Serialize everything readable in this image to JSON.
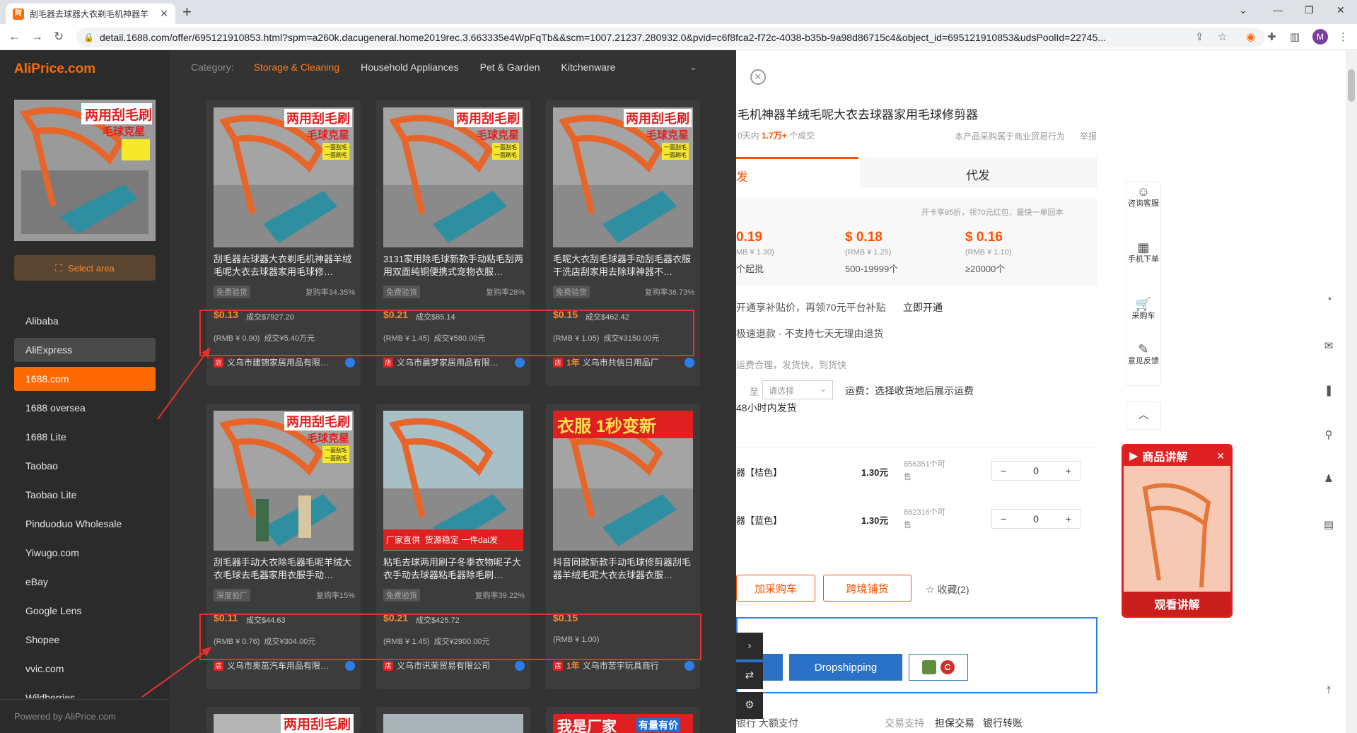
{
  "browser": {
    "tab_title": "刮毛器去球器大衣剃毛机神器羊",
    "tab_close": "✕",
    "new_tab": "+",
    "url": "detail.1688.com/offer/695121910853.html?spm=a260k.dacugeneral.home2019rec.3.663335e4WpFqTb&&scm=1007.21237.280932.0&pvid=c6f8fca2-f72c-4038-b35b-9a98d86715c4&object_id=695121910853&udsPoolId=22745...",
    "profile_initial": "M"
  },
  "sidebar": {
    "logo": "AliPrice.com",
    "select_area": "Select area",
    "sites": [
      "Alibaba",
      "AliExpress",
      "1688.com",
      "1688 oversea",
      "1688 Lite",
      "Taobao",
      "Taobao Lite",
      "Pinduoduo Wholesale",
      "Yiwugo.com",
      "eBay",
      "Google Lens",
      "Shopee",
      "vvic.com",
      "Wildberries"
    ],
    "selected_site": "1688.com",
    "powered_by": "Powered by AliPrice.com"
  },
  "results": {
    "category_label": "Category:",
    "categories": [
      "Storage & Cleaning",
      "Household Appliances",
      "Pet & Garden",
      "Kitchenware"
    ],
    "active_category": "Storage & Cleaning",
    "products": [
      {
        "title": "刮毛器去球器大衣剃毛机神器羊绒毛呢大衣去球器家用毛球修…",
        "badge": "免费验货",
        "repurchase": "复购率34.35%",
        "price": "$0.13",
        "deal_usd": "成交$7927.20",
        "rmb": "(RMB ¥ 0.90)",
        "deal_rmb": "成交¥5.40万元",
        "supplier": "义乌市建锦家居用品有限…",
        "years": ""
      },
      {
        "title": "3131家用除毛球新款手动粘毛刮两用双面纯铜便携式宠物衣服…",
        "badge": "免费验货",
        "repurchase": "复购率28%",
        "price": "$0.21",
        "deal_usd": "成交$85.14",
        "rmb": "(RMB ¥ 1.45)",
        "deal_rmb": "成交¥580.00元",
        "supplier": "义乌市晨梦家居用品有限…",
        "years": ""
      },
      {
        "title": "毛呢大衣刮毛球器手动刮毛器衣服干洗店刮家用去除球神器不…",
        "badge": "免费验货",
        "repurchase": "复购率36.73%",
        "price": "$0.15",
        "deal_usd": "成交$462.42",
        "rmb": "(RMB ¥ 1.05)",
        "deal_rmb": "成交¥3150.00元",
        "supplier": "义乌市共信日用品厂",
        "years": "1年"
      },
      {
        "title": "刮毛器手动大衣除毛器毛呢羊绒大衣毛球去毛器家用衣服手动…",
        "badge": "深度验厂",
        "repurchase": "复购率15%",
        "price": "$0.11",
        "deal_usd": "成交$44.63",
        "rmb": "(RMB ¥ 0.76)",
        "deal_rmb": "成交¥304.00元",
        "supplier": "义乌市奥茁汽车用品有限…",
        "years": ""
      },
      {
        "title": "粘毛去球两用刷子冬季衣物呢子大衣手动去球器粘毛器除毛刷…",
        "badge": "免费验货",
        "repurchase": "复购率39.22%",
        "price": "$0.21",
        "deal_usd": "成交$425.72",
        "rmb": "(RMB ¥ 1.45)",
        "deal_rmb": "成交¥2900.00元",
        "supplier": "义乌市讯荣贸易有限公司",
        "years": ""
      },
      {
        "title": "抖音同款新款手动毛球修剪器刮毛器羊绒毛呢大衣去球器衣服…",
        "badge": "",
        "repurchase": "",
        "price": "$0.15",
        "deal_usd": "",
        "rmb": "(RMB ¥ 1.00)",
        "deal_rmb": "",
        "supplier": "义乌市苦宇玩具商行",
        "years": "1年"
      }
    ],
    "image_texts": {
      "a1": "两用刮毛刷",
      "a2": "毛球克星",
      "a3": "一面刮毛",
      "a4": "一面刷毛",
      "b1": "衣服 1秒变新",
      "c1": "厂家直供",
      "c2": "货源稳定 一件dai发",
      "d1": "我是厂家",
      "d2": "有量有价"
    }
  },
  "page": {
    "title": "毛机神器羊绒毛呢大衣去球器家用毛球修剪器",
    "sold_prefix": "0天内",
    "sold_count": "1.7万+",
    "sold_suffix": "个成交",
    "trade_note": "本产品采购属于商业贸易行为",
    "report": "举报",
    "tab_wholesale": "发",
    "tab_dropship": "代发",
    "coupon_text": "开卡享95折，领70元红包，最快一单回本",
    "tiers": [
      {
        "price": "0.19",
        "rmb": "MB ¥ 1.30)",
        "qty": "个起批"
      },
      {
        "price": "$ 0.18",
        "rmb": "(RMB ¥ 1.25)",
        "qty": "500-19999个"
      },
      {
        "price": "$ 0.16",
        "rmb": "(RMB ¥ 1.10)",
        "qty": "≥20000个"
      }
    ],
    "promo": "开通享补贴价，再领70元平台补贴",
    "promo_link": "立即开通",
    "refund": "极速退款 · 不支持七天无理由退货",
    "shipping_note": "运费合理，发货快，到货快",
    "ship_to_label": "至",
    "ship_select": "请选择",
    "freight": "运费：选择收货地后展示运费",
    "ship_time": "48小时内发货",
    "variants": [
      {
        "name": "器【桔色】",
        "price": "1.30元",
        "stock_a": "856351个可",
        "stock_b": "售",
        "qty": "0"
      },
      {
        "name": "器【蓝色】",
        "price": "1.30元",
        "stock_a": "862316个可",
        "stock_b": "售",
        "qty": "0"
      }
    ],
    "add_cart": "加采购车",
    "cross_border": "跨境铺货",
    "favorite": "收藏(2)",
    "dropshipping": "Dropshipping",
    "bottom_left": "银行  大额支付",
    "bottom_mid": "交易支持",
    "bottom_a": "担保交易",
    "bottom_b": "银行转账",
    "tools": [
      {
        "icon": "chat-icon",
        "label": "咨询客服"
      },
      {
        "icon": "mobile-qr-icon",
        "label": "手机下单"
      },
      {
        "icon": "cart-icon",
        "label": "采购车"
      },
      {
        "icon": "feedback-icon",
        "label": "意见反馈"
      }
    ],
    "video_title": "商品讲解",
    "video_btn": "观看讲解",
    "video_close": "✕"
  },
  "colors": {
    "accent": "#ff6a00",
    "highlight_box": "#e8312f",
    "sidebar_bg": "#2b2b2b",
    "panel_bg": "#333333"
  }
}
